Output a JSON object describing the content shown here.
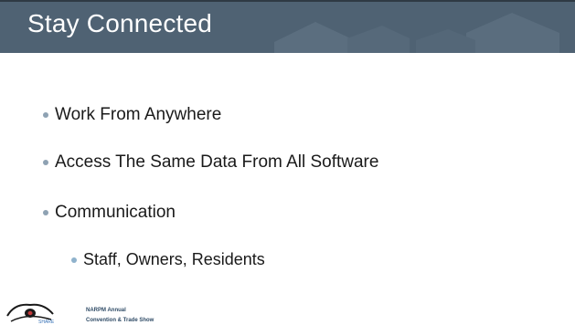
{
  "slide": {
    "title": "Stay Connected",
    "bullets": [
      "Work From Anywhere",
      "Access The Same Data From All Software",
      "Communication"
    ],
    "sub_bullets": [
      "Staff, Owners, Residents"
    ]
  },
  "footer": {
    "logo_text": "SHARE",
    "line1": "NARPM Annual",
    "line2": "Convention & Trade Show"
  },
  "colors": {
    "header_bg": "#4f6273",
    "bullet": "#8ea2b3",
    "sub_bullet": "#8fb2cc",
    "text": "#1a1a1a"
  }
}
